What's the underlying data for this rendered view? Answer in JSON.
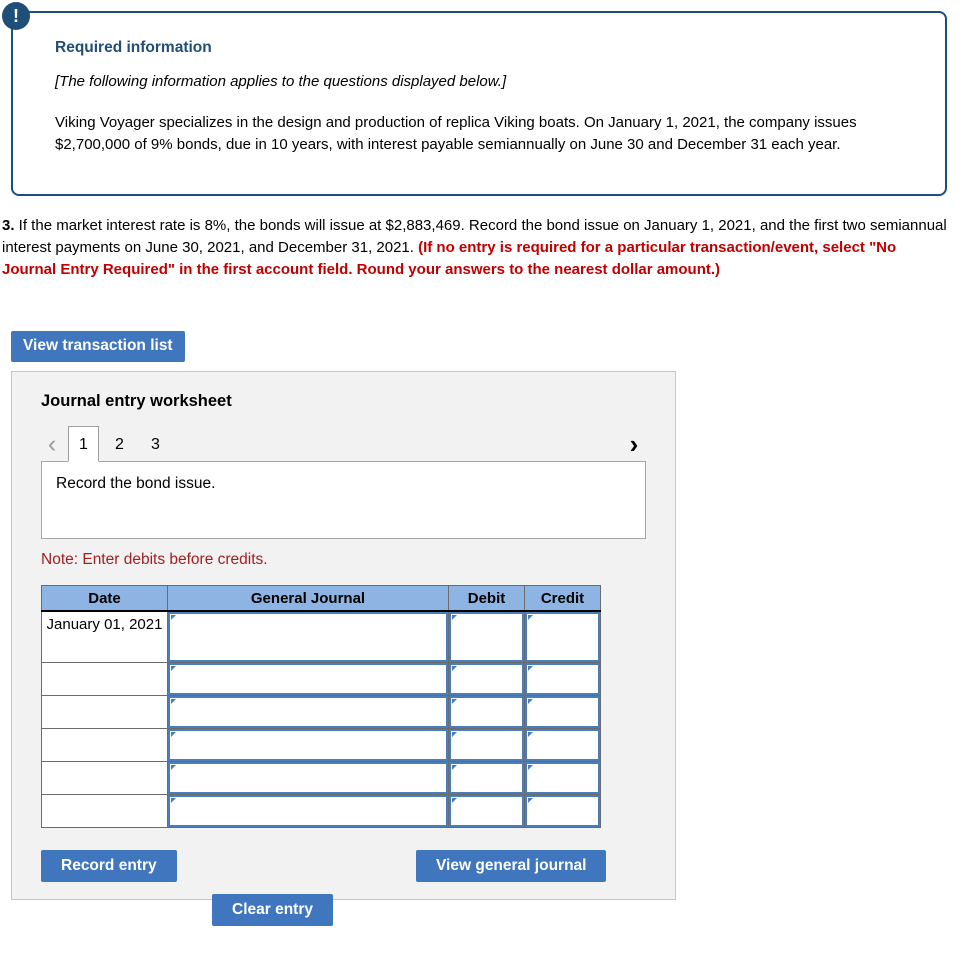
{
  "callout": {
    "icon": "exclamation-icon",
    "title": "Required information",
    "italic_note": "[The following information applies to the questions displayed below.]",
    "body": "Viking Voyager specializes in the design and production of replica Viking boats. On January 1, 2021, the company issues $2,700,000 of 9% bonds, due in 10 years, with interest payable semiannually on June 30 and December 31 each year.",
    "border_color": "#1f4e79",
    "title_color": "#1f4e79"
  },
  "question": {
    "number": "3.",
    "text_black": " If the market interest rate is 8%, the bonds will issue at $2,883,469. Record the bond issue on January 1, 2021, and the first two semiannual interest payments on June 30, 2021, and December 31, 2021. ",
    "text_red": "(If no entry is required for a particular transaction/event, select \"No Journal Entry Required\" in the first account field. Round your answers to the nearest dollar amount.)",
    "red_color": "#c00000"
  },
  "buttons": {
    "view_transaction_list": "View transaction list",
    "record_entry": "Record entry",
    "clear_entry": "Clear entry",
    "view_general_journal": "View general journal",
    "blue": "#3f76bd"
  },
  "worksheet": {
    "title": "Journal entry worksheet",
    "prev_icon": "chevron-left-icon",
    "next_icon": "chevron-right-icon",
    "tabs": [
      {
        "label": "1",
        "active": true
      },
      {
        "label": "2",
        "active": false
      },
      {
        "label": "3",
        "active": false
      }
    ],
    "description": "Record the bond issue.",
    "note": "Note: Enter debits before credits.",
    "note_color": "#a02020"
  },
  "journal_table": {
    "header_color": "#8db4e2",
    "field_border_color": "#4a7ebb",
    "columns": [
      "Date",
      "General Journal",
      "Debit",
      "Credit"
    ],
    "rows": [
      {
        "date": "January 01, 2021",
        "general_journal": "",
        "debit": "",
        "credit": "",
        "tall": true
      },
      {
        "date": "",
        "general_journal": "",
        "debit": "",
        "credit": "",
        "tall": false
      },
      {
        "date": "",
        "general_journal": "",
        "debit": "",
        "credit": "",
        "tall": false
      },
      {
        "date": "",
        "general_journal": "",
        "debit": "",
        "credit": "",
        "tall": false
      },
      {
        "date": "",
        "general_journal": "",
        "debit": "",
        "credit": "",
        "tall": false
      },
      {
        "date": "",
        "general_journal": "",
        "debit": "",
        "credit": "",
        "tall": false
      }
    ]
  }
}
